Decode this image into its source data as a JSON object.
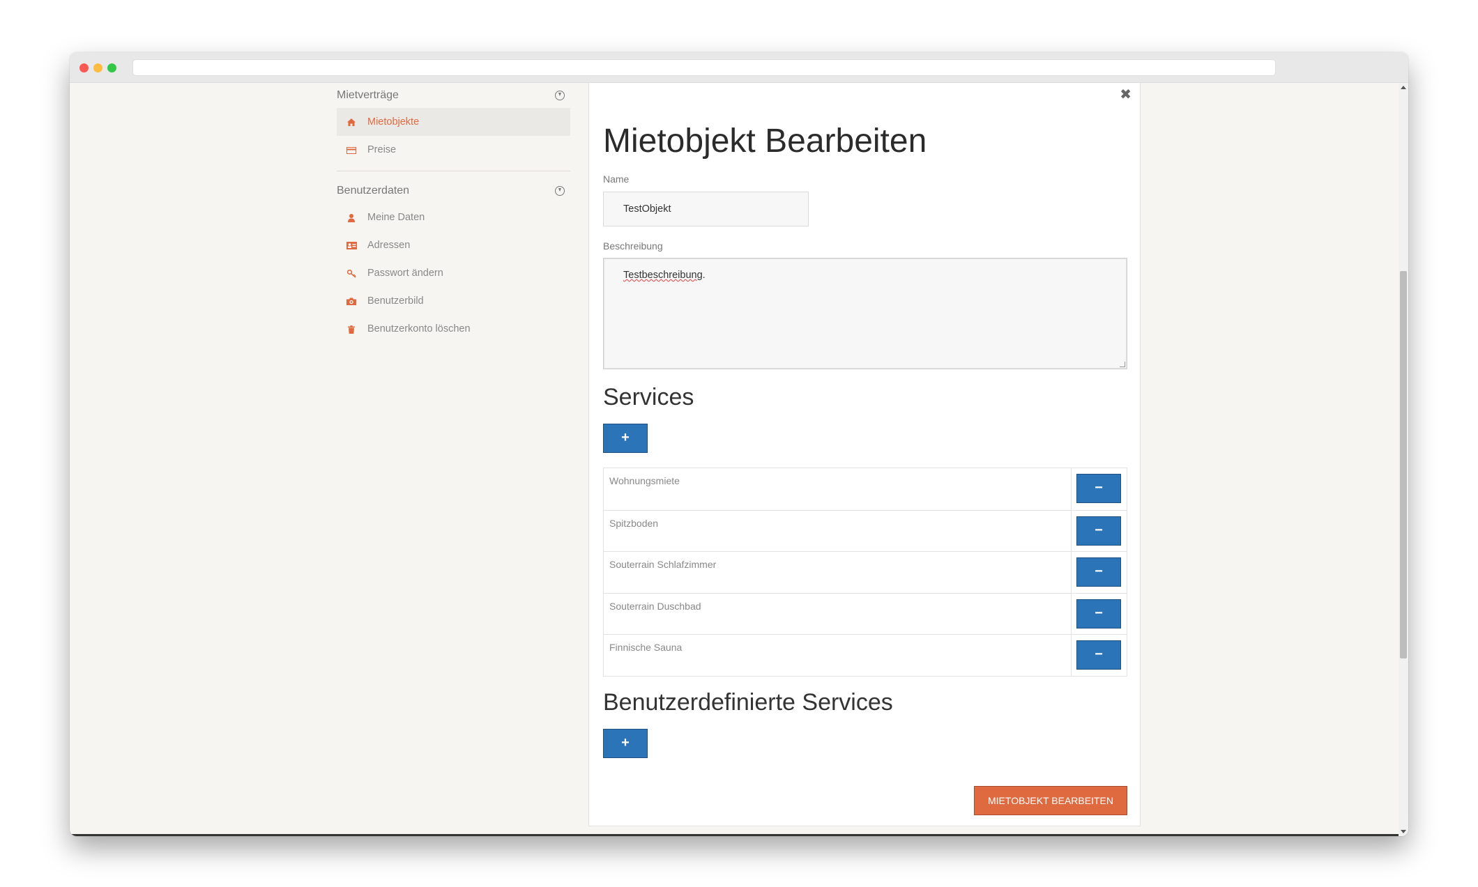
{
  "sidebar": {
    "sections": [
      {
        "title": "Mietverträge",
        "items": [
          {
            "label": "Mietobjekte",
            "icon": "home-icon",
            "active": true
          },
          {
            "label": "Preise",
            "icon": "credit-card-icon",
            "active": false
          }
        ]
      },
      {
        "title": "Benutzerdaten",
        "items": [
          {
            "label": "Meine Daten",
            "icon": "user-icon",
            "active": false
          },
          {
            "label": "Adressen",
            "icon": "address-card-icon",
            "active": false
          },
          {
            "label": "Passwort ändern",
            "icon": "key-icon",
            "active": false
          },
          {
            "label": "Benutzerbild",
            "icon": "camera-icon",
            "active": false
          },
          {
            "label": "Benutzerkonto löschen",
            "icon": "trash-icon",
            "active": false
          }
        ]
      }
    ]
  },
  "form": {
    "close_glyph": "✖",
    "title": "Mietobjekt Bearbeiten",
    "name_label": "Name",
    "name_value": "TestObjekt",
    "description_label": "Beschreibung",
    "description_word": "Testbeschreibung",
    "description_punct": ".",
    "services_heading": "Services",
    "add_glyph": "+",
    "remove_glyph": "−",
    "services": [
      "Wohnungsmiete",
      "Spitzboden",
      "Souterrain Schlafzimmer",
      "Souterrain Duschbad",
      "Finnische Sauna"
    ],
    "custom_services_heading": "Benutzerdefinierte Services",
    "submit_label": "MIETOBJEKT BEARBEITEN"
  },
  "colors": {
    "accent": "#e06a40",
    "primary_button": "#2c74b8"
  }
}
